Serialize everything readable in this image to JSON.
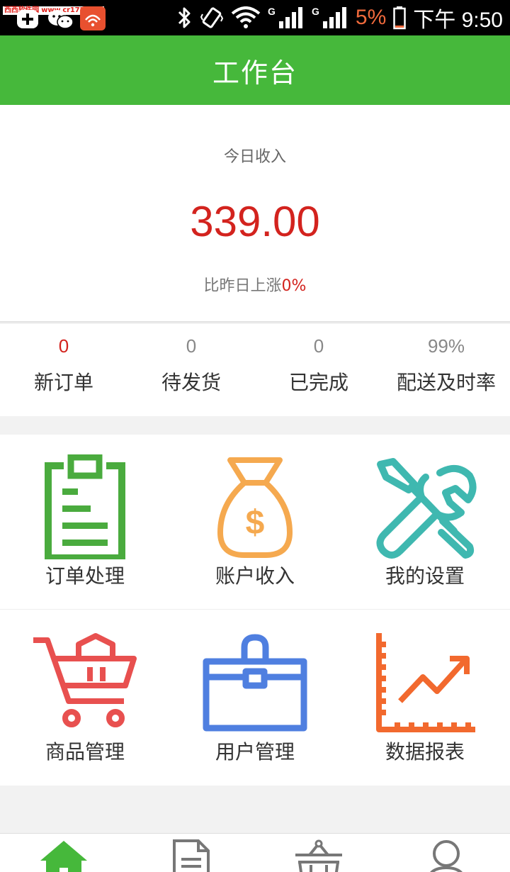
{
  "status_bar": {
    "watermark": "西西软件园 www.cr173.com",
    "battery": "5%",
    "time": "下午 9:50"
  },
  "header": {
    "title": "工作台"
  },
  "income": {
    "label": "今日收入",
    "amount": "339.00",
    "compare_prefix": "比昨日上涨",
    "compare_percent": "0%"
  },
  "stats": [
    {
      "value": "0",
      "label": "新订单"
    },
    {
      "value": "0",
      "label": "待发货"
    },
    {
      "value": "0",
      "label": "已完成"
    },
    {
      "value": "99%",
      "label": "配送及时率"
    }
  ],
  "tiles": [
    {
      "label": "订单处理",
      "icon": "clipboard-icon"
    },
    {
      "label": "账户收入",
      "icon": "money-bag-icon"
    },
    {
      "label": "我的设置",
      "icon": "tools-icon"
    },
    {
      "label": "商品管理",
      "icon": "shopping-cart-icon"
    },
    {
      "label": "用户管理",
      "icon": "briefcase-icon"
    },
    {
      "label": "数据报表",
      "icon": "chart-icon"
    }
  ],
  "tabbar": [
    {
      "icon": "home-icon"
    },
    {
      "icon": "document-icon"
    },
    {
      "icon": "basket-icon"
    },
    {
      "icon": "user-icon"
    }
  ],
  "colors": {
    "header_green": "#46b83b",
    "amount_red": "#d3231e",
    "clipboard_green": "#4aab3e",
    "bag_orange": "#f5a94f",
    "tools_teal": "#3fb8b0",
    "cart_red": "#e8504f",
    "briefcase_blue": "#4f7fe0",
    "chart_orange": "#f2692e"
  }
}
